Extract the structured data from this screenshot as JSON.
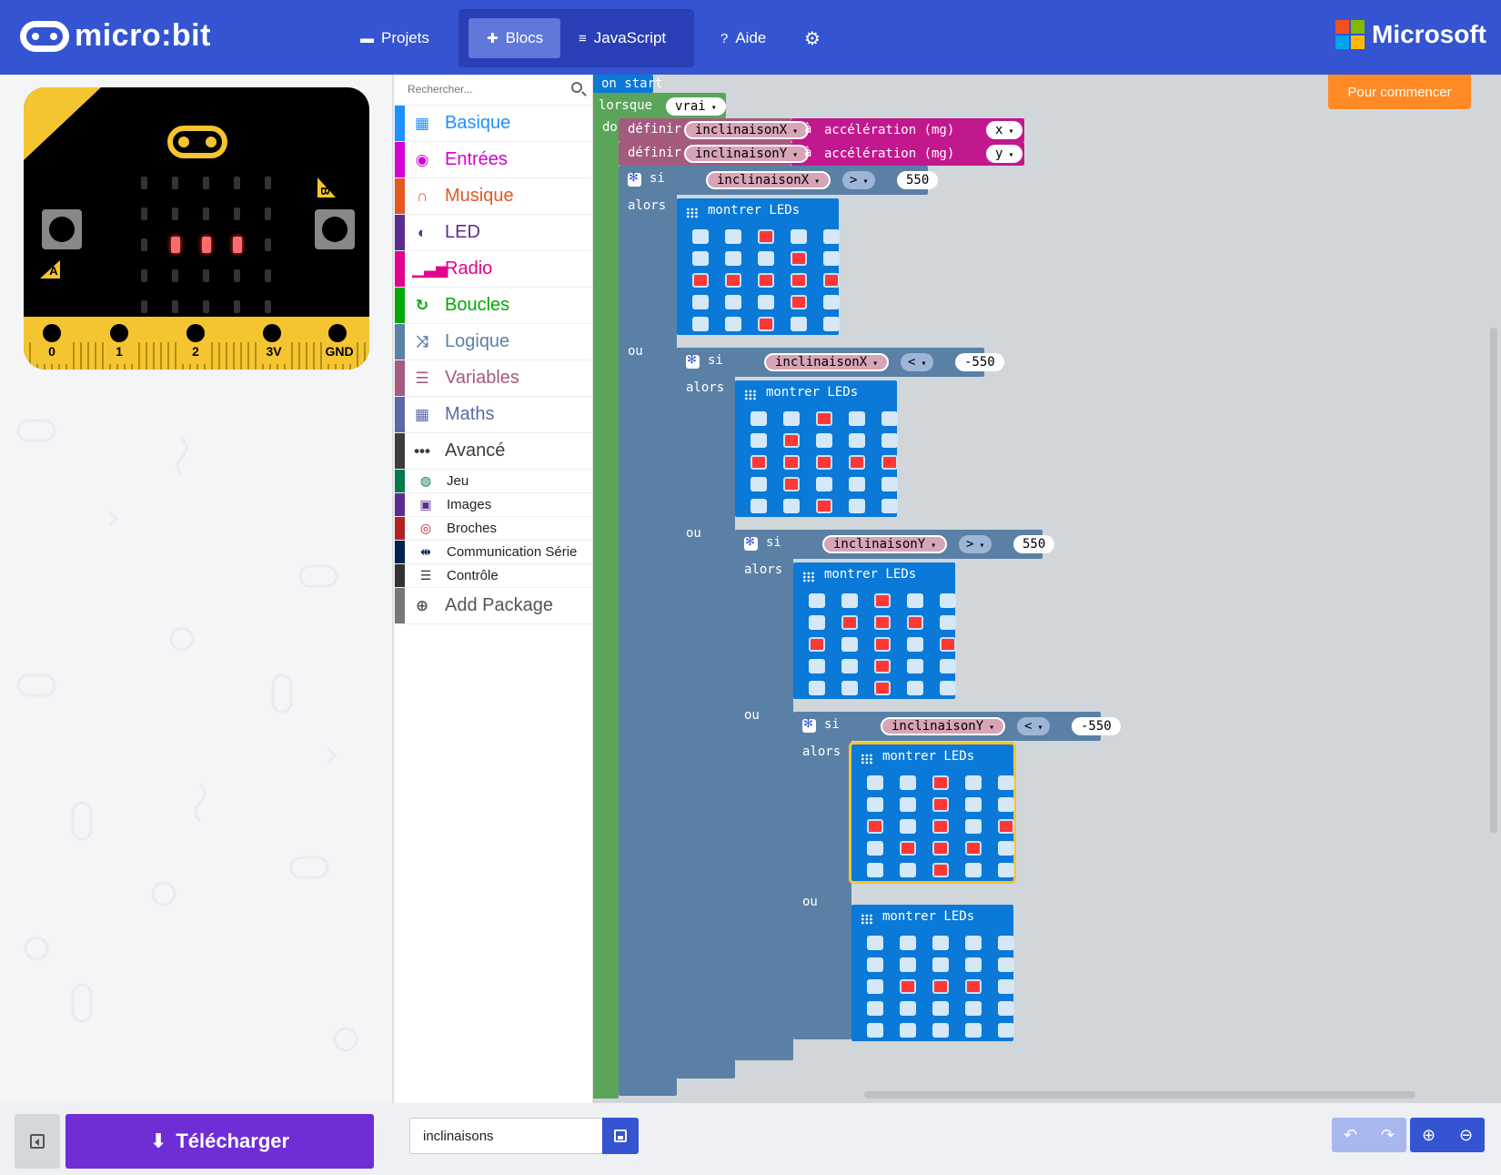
{
  "header": {
    "app_name": "micro:bit",
    "nav": [
      {
        "label": "Projets",
        "icon": "folder-icon"
      },
      {
        "label": "Blocs",
        "icon": "puzzle-icon",
        "active": true
      },
      {
        "label": "JavaScript",
        "icon": "code-icon"
      },
      {
        "label": "Aide",
        "icon": "help-icon"
      },
      {
        "label": "",
        "icon": "gear-icon"
      }
    ],
    "brand": "Microsoft"
  },
  "simulator": {
    "pin_labels": [
      "0",
      "1",
      "2",
      "3V",
      "GND"
    ],
    "button_a": "A",
    "button_b": "B",
    "leds": [
      [
        0,
        0,
        0,
        0,
        0
      ],
      [
        0,
        0,
        0,
        0,
        0
      ],
      [
        0,
        1,
        1,
        1,
        0
      ],
      [
        0,
        0,
        0,
        0,
        0
      ],
      [
        0,
        0,
        0,
        0,
        0
      ]
    ]
  },
  "toolbox": {
    "search_placeholder": "Rechercher...",
    "categories": [
      {
        "label": "Basique",
        "color": "#1e90ff",
        "icon": "grid-icon"
      },
      {
        "label": "Entrées",
        "color": "#d400d4",
        "icon": "target-icon"
      },
      {
        "label": "Musique",
        "color": "#e65722",
        "icon": "headphones-icon"
      },
      {
        "label": "LED",
        "color": "#5c2d91",
        "icon": "toggle-icon"
      },
      {
        "label": "Radio",
        "color": "#e3008c",
        "icon": "signal-icon"
      },
      {
        "label": "Boucles",
        "color": "#00aa00",
        "icon": "loop-icon"
      },
      {
        "label": "Logique",
        "color": "#5c81a6",
        "icon": "shuffle-icon"
      },
      {
        "label": "Variables",
        "color": "#a55b80",
        "icon": "lines-icon"
      },
      {
        "label": "Maths",
        "color": "#5c68a6",
        "icon": "calculator-icon"
      },
      {
        "label": "Avancé",
        "color": "#3c3c3c",
        "icon": "more-icon"
      }
    ],
    "advanced": [
      {
        "label": "Jeu",
        "color": "#007a4b",
        "icon": "gamepad-icon"
      },
      {
        "label": "Images",
        "color": "#5c2d91",
        "icon": "image-icon"
      },
      {
        "label": "Broches",
        "color": "#b22222",
        "icon": "pin-icon"
      },
      {
        "label": "Communication Série",
        "color": "#002050",
        "icon": "usb-icon"
      },
      {
        "label": "Contrôle",
        "color": "#333333",
        "icon": "server-icon"
      }
    ],
    "add_package": "Add Package"
  },
  "workspace": {
    "on_start": "on start",
    "while_label": "lorsque",
    "while_value": "vrai",
    "do_label": "do",
    "set_label": "définir",
    "to_label": "à",
    "accel_label": "accélération (mg)",
    "set1": {
      "var": "inclinaisonX",
      "axis": "x"
    },
    "set2": {
      "var": "inclinaisonY",
      "axis": "y"
    },
    "if_label": "si",
    "then_label": "alors",
    "else_label": "ou",
    "show_leds": "montrer LEDs",
    "conditions": [
      {
        "var": "inclinaisonX",
        "op": ">",
        "value": "550"
      },
      {
        "var": "inclinaisonX",
        "op": "<",
        "value": "-550"
      },
      {
        "var": "inclinaisonY",
        "op": ">",
        "value": "550"
      },
      {
        "var": "inclinaisonY",
        "op": "<",
        "value": "-550"
      }
    ],
    "led_patterns": [
      [
        [
          0,
          0,
          1,
          0,
          0
        ],
        [
          0,
          0,
          0,
          1,
          0
        ],
        [
          1,
          1,
          1,
          1,
          1
        ],
        [
          0,
          0,
          0,
          1,
          0
        ],
        [
          0,
          0,
          1,
          0,
          0
        ]
      ],
      [
        [
          0,
          0,
          1,
          0,
          0
        ],
        [
          0,
          1,
          0,
          0,
          0
        ],
        [
          1,
          1,
          1,
          1,
          1
        ],
        [
          0,
          1,
          0,
          0,
          0
        ],
        [
          0,
          0,
          1,
          0,
          0
        ]
      ],
      [
        [
          0,
          0,
          1,
          0,
          0
        ],
        [
          0,
          1,
          1,
          1,
          0
        ],
        [
          1,
          0,
          1,
          0,
          1
        ],
        [
          0,
          0,
          1,
          0,
          0
        ],
        [
          0,
          0,
          1,
          0,
          0
        ]
      ],
      [
        [
          0,
          0,
          1,
          0,
          0
        ],
        [
          0,
          0,
          1,
          0,
          0
        ],
        [
          1,
          0,
          1,
          0,
          1
        ],
        [
          0,
          1,
          1,
          1,
          0
        ],
        [
          0,
          0,
          1,
          0,
          0
        ]
      ],
      [
        [
          0,
          0,
          0,
          0,
          0
        ],
        [
          0,
          0,
          0,
          0,
          0
        ],
        [
          0,
          1,
          1,
          1,
          0
        ],
        [
          0,
          0,
          0,
          0,
          0
        ],
        [
          0,
          0,
          0,
          0,
          0
        ]
      ]
    ]
  },
  "getting_started": "Pour commencer",
  "bottom": {
    "download_label": "Télécharger",
    "project_name": "inclinaisons"
  }
}
